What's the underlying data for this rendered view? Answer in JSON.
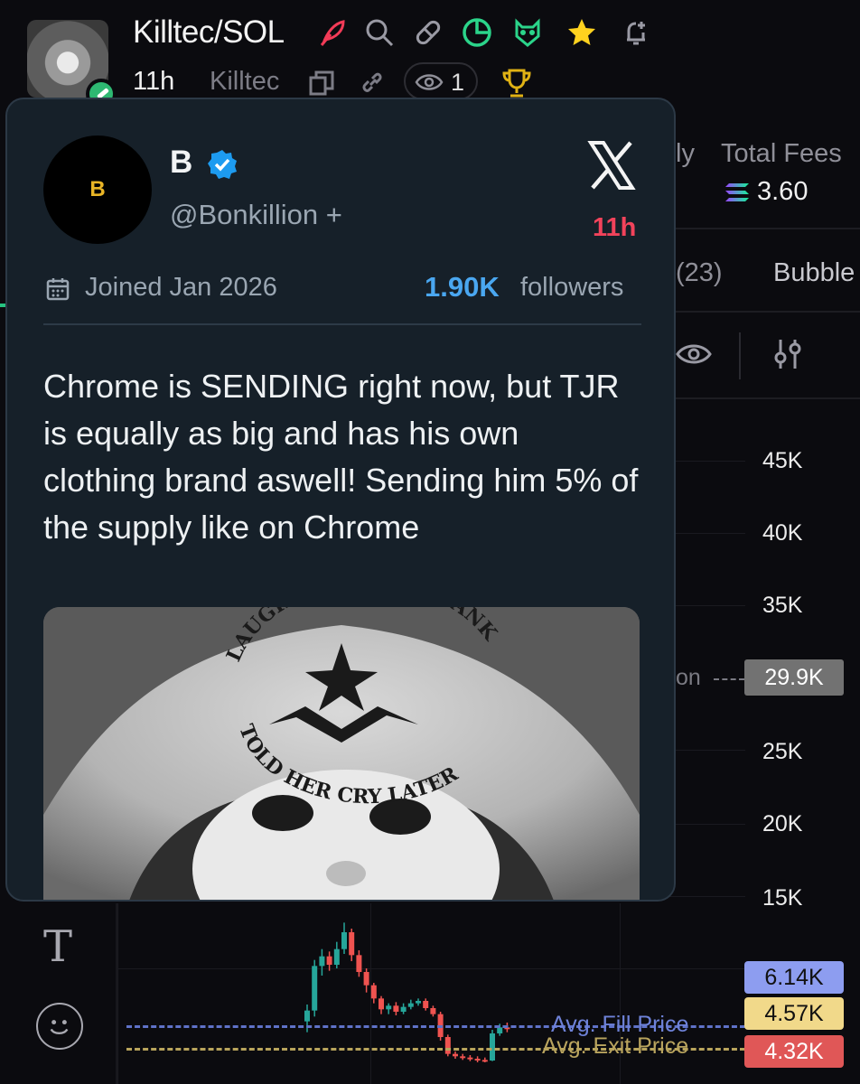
{
  "header": {
    "token_name": "Killtec/SOL",
    "age": "11h",
    "dev_name": "Killtec",
    "viewers": "1",
    "icons": [
      "feather-icon",
      "search-icon",
      "pill-icon",
      "pie-chart-icon",
      "owl-icon",
      "star-icon",
      "bell-plus-icon",
      "copy-icon",
      "link-icon",
      "eye-icon",
      "trophy-icon"
    ]
  },
  "side_panel": {
    "ly_fragment": "ly",
    "fees_label": "Total Fees",
    "fees_value": "3.60",
    "tab_count": "(23)",
    "tab_bubble": "Bubble"
  },
  "chart": {
    "y_ticks": [
      "45K",
      "40K",
      "35K",
      "25K",
      "20K",
      "15K"
    ],
    "current_price": "29.9K",
    "current_line_fragment": "on",
    "fill_price": "6.14K",
    "fill_label": "Avg. Fill Price",
    "exit_price_1": "4.57K",
    "exit_price_2": "4.32K",
    "exit_label": "Avg. Exit Price",
    "colors": {
      "up": "#26a69a",
      "down": "#ef5350",
      "fill_badge": "#8d9df0",
      "exit_badge": "#f1d98a",
      "sell_badge": "#e05757"
    }
  },
  "chart_data": {
    "type": "candlestick",
    "ylim": [
      0,
      47000
    ],
    "y_ticks": [
      15000,
      20000,
      25000,
      35000,
      40000,
      45000
    ],
    "candles": [
      {
        "o": 5200,
        "c": 6100,
        "h": 6600,
        "l": 4300
      },
      {
        "o": 6100,
        "c": 9800,
        "h": 10300,
        "l": 5600
      },
      {
        "o": 9800,
        "c": 10600,
        "h": 11200,
        "l": 9000
      },
      {
        "o": 10600,
        "c": 9900,
        "h": 11000,
        "l": 9400
      },
      {
        "o": 9900,
        "c": 11200,
        "h": 11800,
        "l": 9600
      },
      {
        "o": 11200,
        "c": 12600,
        "h": 13400,
        "l": 10800
      },
      {
        "o": 12600,
        "c": 10700,
        "h": 12900,
        "l": 10200
      },
      {
        "o": 10700,
        "c": 9300,
        "h": 11100,
        "l": 8900
      },
      {
        "o": 9300,
        "c": 8200,
        "h": 9600,
        "l": 7600
      },
      {
        "o": 8200,
        "c": 7100,
        "h": 8400,
        "l": 6700
      },
      {
        "o": 7100,
        "c": 6200,
        "h": 7300,
        "l": 5800
      },
      {
        "o": 6200,
        "c": 6500,
        "h": 6700,
        "l": 5800
      },
      {
        "o": 6500,
        "c": 6000,
        "h": 6800,
        "l": 5700
      },
      {
        "o": 6000,
        "c": 6400,
        "h": 6700,
        "l": 5800
      },
      {
        "o": 6400,
        "c": 6700,
        "h": 7000,
        "l": 6200
      },
      {
        "o": 6700,
        "c": 6900,
        "h": 7100,
        "l": 6500
      },
      {
        "o": 6900,
        "c": 6300,
        "h": 7100,
        "l": 6100
      },
      {
        "o": 6300,
        "c": 5800,
        "h": 6500,
        "l": 5600
      },
      {
        "o": 5800,
        "c": 3900,
        "h": 6000,
        "l": 3600
      },
      {
        "o": 3900,
        "c": 2500,
        "h": 4100,
        "l": 2300
      },
      {
        "o": 2500,
        "c": 2300,
        "h": 2700,
        "l": 2100
      },
      {
        "o": 2300,
        "c": 2200,
        "h": 2500,
        "l": 2000
      },
      {
        "o": 2200,
        "c": 2100,
        "h": 2400,
        "l": 1900
      },
      {
        "o": 2100,
        "c": 2000,
        "h": 2300,
        "l": 1800
      },
      {
        "o": 2000,
        "c": 1950,
        "h": 2200,
        "l": 1800
      },
      {
        "o": 1950,
        "c": 4200,
        "h": 4500,
        "l": 1900
      },
      {
        "o": 4200,
        "c": 4700,
        "h": 5000,
        "l": 4000
      },
      {
        "o": 4700,
        "c": 4600,
        "h": 5100,
        "l": 4300
      }
    ]
  },
  "tweet": {
    "avatar_letter": "B",
    "name": "B",
    "handle": "@Bonkillion +",
    "time": "11h",
    "joined": "Joined Jan 2026",
    "followers_count": "1.90K",
    "followers_label": "followers",
    "text": "Chrome is SENDING right now, but TJR is equally as big and has his own clothing brand aswell! Sending him 5% of the supply like on Chrome",
    "media_text_top": "LAUGHING TO THE BANK",
    "media_text_bottom": "TOLD HER CRY LATER"
  }
}
